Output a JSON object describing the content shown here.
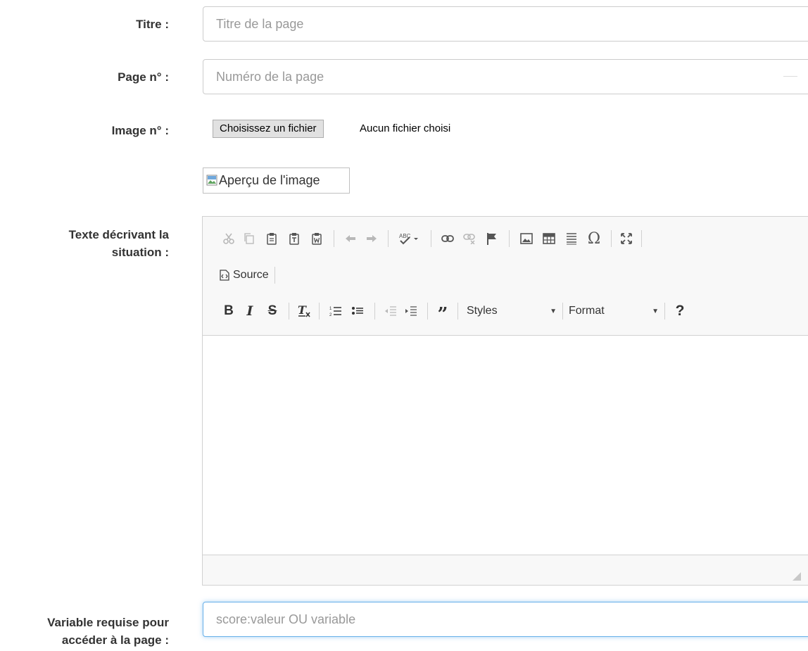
{
  "fields": {
    "title": {
      "label": "Titre :",
      "placeholder": "Titre de la page"
    },
    "page_number": {
      "label": "Page n° :",
      "placeholder": "Numéro de la page"
    },
    "image": {
      "label": "Image n° :",
      "button": "Choisissez un fichier",
      "status": "Aucun fichier choisi",
      "preview_alt": "Aperçu de l'image"
    },
    "description": {
      "label_line1": "Texte décrivant la",
      "label_line2": "situation :"
    },
    "required_variable": {
      "label_line1": "Variable requise pour",
      "label_line2": "accéder à la page :",
      "placeholder": "score:valeur OU variable"
    }
  },
  "editor": {
    "source_label": "Source",
    "styles_label": "Styles",
    "format_label": "Format",
    "row1_icons": [
      "cut-icon",
      "copy-icon",
      "paste-icon",
      "paste-text-icon",
      "paste-word-icon",
      "undo-icon",
      "redo-icon",
      "spellcheck-icon",
      "link-icon",
      "unlink-icon",
      "anchor-icon",
      "image-icon",
      "table-icon",
      "horizontal-line-icon",
      "special-char-icon",
      "maximize-icon"
    ],
    "row3_icons": [
      "bold-icon",
      "italic-icon",
      "strike-icon",
      "remove-format-icon",
      "numbered-list-icon",
      "bulleted-list-icon",
      "outdent-icon",
      "indent-icon",
      "blockquote-icon",
      "help-icon"
    ]
  },
  "colors": {
    "focus_border": "#66afe9",
    "label": "#333333",
    "placeholder": "#999999"
  }
}
